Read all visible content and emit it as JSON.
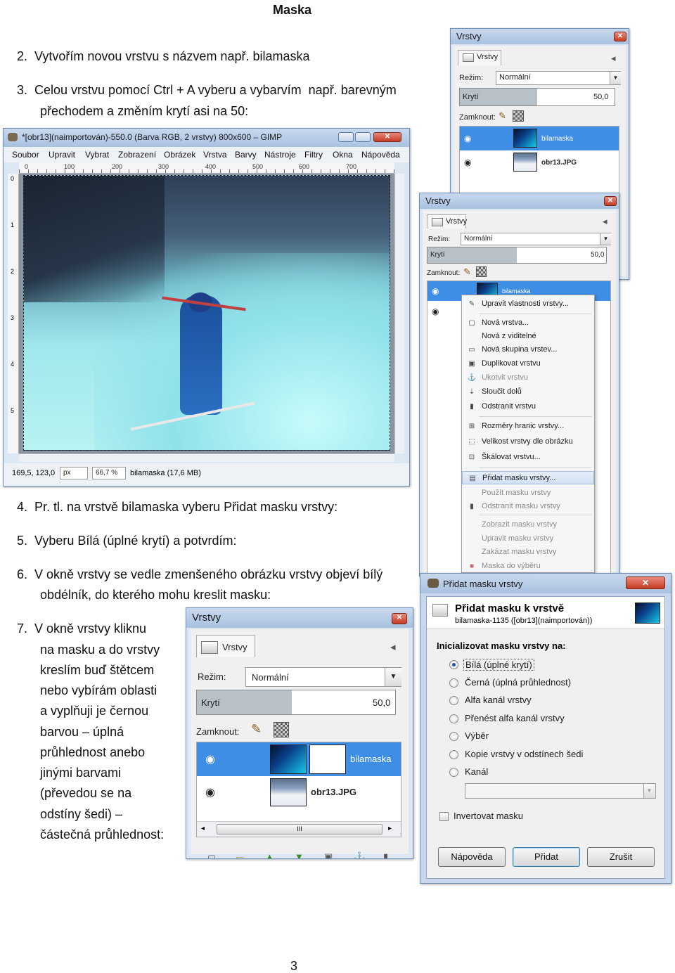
{
  "document": {
    "title": "Maska",
    "step2": "2.  Vytvořím novou vrstvu s názvem např. bilamaska",
    "step3_line1": "3.  Celou vrstvu pomocí Ctrl + A vyberu a vybarvím  např. barevným",
    "step3_line2": "přechodem a změním krytí asi na 50:",
    "step4": "4.  Pr. tl. na vrstvě bilamaska vyberu Přidat masku vrstvy:",
    "step5": "5.  Vyberu Bílá (úplné krytí) a potvrdím:",
    "step6_line1": "6.  V okně vrstvy se vedle zmenšeného obrázku vrstvy objeví bílý",
    "step6_line2": "obdélník, do kterého mohu kreslit masku:",
    "step7_lines": [
      "7.  V okně vrstvy kliknu",
      "na masku a do vrstvy",
      "kreslím buď štětcem",
      "nebo vybírám oblasti",
      "a vyplňuji je černou",
      "barvou – úplná",
      "průhlednost anebo",
      "jinými barvami",
      "(převedou se na",
      "odstíny šedi) –",
      "částečná průhlednost:"
    ],
    "page_number": "3"
  },
  "gimp_window": {
    "title": "*[obr13](naimportován)-550.0 (Barva RGB, 2 vrstvy) 800x600 – GIMP",
    "menu": [
      "Soubor",
      "Upravit",
      "Vybrat",
      "Zobrazení",
      "Obrázek",
      "Vrstva",
      "Barvy",
      "Nástroje",
      "Filtry",
      "Okna",
      "Nápověda"
    ],
    "ruler_ticks": [
      "0",
      "100",
      "200",
      "300",
      "400",
      "500",
      "600",
      "700"
    ],
    "ruler_v_ticks": [
      "0",
      "1",
      "2",
      "3",
      "4",
      "5"
    ],
    "status_coords": "169,5, 123,0",
    "status_unit": "px",
    "status_zoom": "66,7 %",
    "status_layer": "bilamaska (17,6 MB)"
  },
  "layers_panel_a": {
    "window_title": "Vrstvy",
    "tab": "Vrstvy",
    "mode_label": "Režim:",
    "mode_value": "Normální",
    "opacity_label": "Krytí",
    "opacity_value": "50,0",
    "lock_label": "Zamknout:",
    "layers": [
      "bilamaska",
      "obr13.JPG"
    ]
  },
  "layers_panel_b": {
    "window_title": "Vrstvy",
    "tab": "Vrstvy",
    "mode_label": "Režim:",
    "mode_value": "Normální",
    "opacity_label": "Krytí",
    "opacity_value": "50,0",
    "lock_label": "Zamknout:",
    "layer_selected": "bilamaska"
  },
  "context_menu": {
    "items": [
      "Upravit vlastnosti vrstvy...",
      "Nová vrstva...",
      "Nová z viditelné",
      "Nová skupina vrstev...",
      "Duplikovat vrstvu",
      "Ukotvit vrstvu",
      "Sloučit dolů",
      "Odstranit vrstvu",
      "Rozměry hranic vrstvy...",
      "Velikost vrstvy dle obrázku",
      "Škálovat vrstvu...",
      "Přidat masku vrstvy...",
      "Použít masku vrstvy",
      "Odstranit masku vrstvy",
      "Zobrazit masku vrstvy",
      "Upravit masku vrstvy",
      "Zakázat masku vrstvy",
      "Maska do výběru"
    ]
  },
  "add_mask_dialog": {
    "window_title": "Přidat masku vrstvy",
    "heading": "Přidat masku k vrstvě",
    "subheading": "bilamaska-1135 ([obr13](naimportován))",
    "init_label": "Inicializovat masku vrstvy na:",
    "options": [
      "Bílá (úplné krytí)",
      "Černá (úplná průhlednost)",
      "Alfa kanál vrstvy",
      "Přenést alfa kanál vrstvy",
      "Výběr",
      "Kopie vrstvy v odstínech šedi",
      "Kanál"
    ],
    "invert_label": "Invertovat masku",
    "btn_help": "Nápověda",
    "btn_add": "Přidat",
    "btn_cancel": "Zrušit"
  },
  "layers_panel_c": {
    "window_title": "Vrstvy",
    "tab": "Vrstvy",
    "mode_label": "Režim:",
    "mode_value": "Normální",
    "opacity_label": "Krytí",
    "opacity_value": "50,0",
    "lock_label": "Zamknout:",
    "layers": [
      "bilamaska",
      "obr13.JPG"
    ],
    "scroll_grip": "III"
  }
}
